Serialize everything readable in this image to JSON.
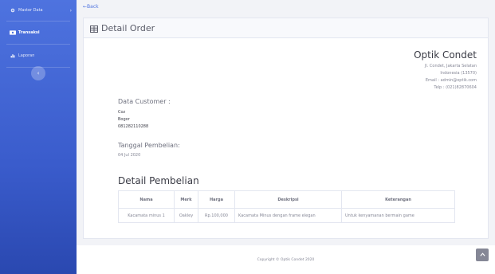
{
  "sidebar": {
    "items": [
      {
        "label": "Master Data",
        "icon": "cog-icon"
      },
      {
        "label": "Transaksi",
        "icon": "money-icon"
      },
      {
        "label": "Laporan",
        "icon": "chart-icon"
      }
    ],
    "toggle_glyph": "‹"
  },
  "nav": {
    "back_label": "←Back"
  },
  "header": {
    "title": "Detail Order"
  },
  "company": {
    "name": "Optik Condet",
    "address1": "Jl. Condet, Jakarta Selatan",
    "address2": "Indonesia (13570)",
    "email": "Email : admin@optik.com",
    "phone": "Telp : (021)82870604"
  },
  "customer": {
    "heading": "Data Customer :",
    "name": "Coz",
    "city": "Bogor",
    "phone": "081282110288"
  },
  "purchase_date": {
    "heading": "Tanggal Pembelian:",
    "value": "04 Jul 2020"
  },
  "detail": {
    "title": "Detail Pembelian",
    "columns": [
      "Nama",
      "Merk",
      "Harga",
      "Deskripsi",
      "Keterangan"
    ],
    "rows": [
      [
        "Kacamata minus 1",
        "Oakley",
        "Rp.100,000",
        "Kacamata Minus dengan frame elegan",
        "Untuk kenyamanan bermain game"
      ]
    ]
  },
  "footer": {
    "copyright": "Copyright © Optik Condet 2020"
  },
  "colors": {
    "sidebar": "#4e73df",
    "accent": "#4e73df",
    "text": "#858796"
  }
}
